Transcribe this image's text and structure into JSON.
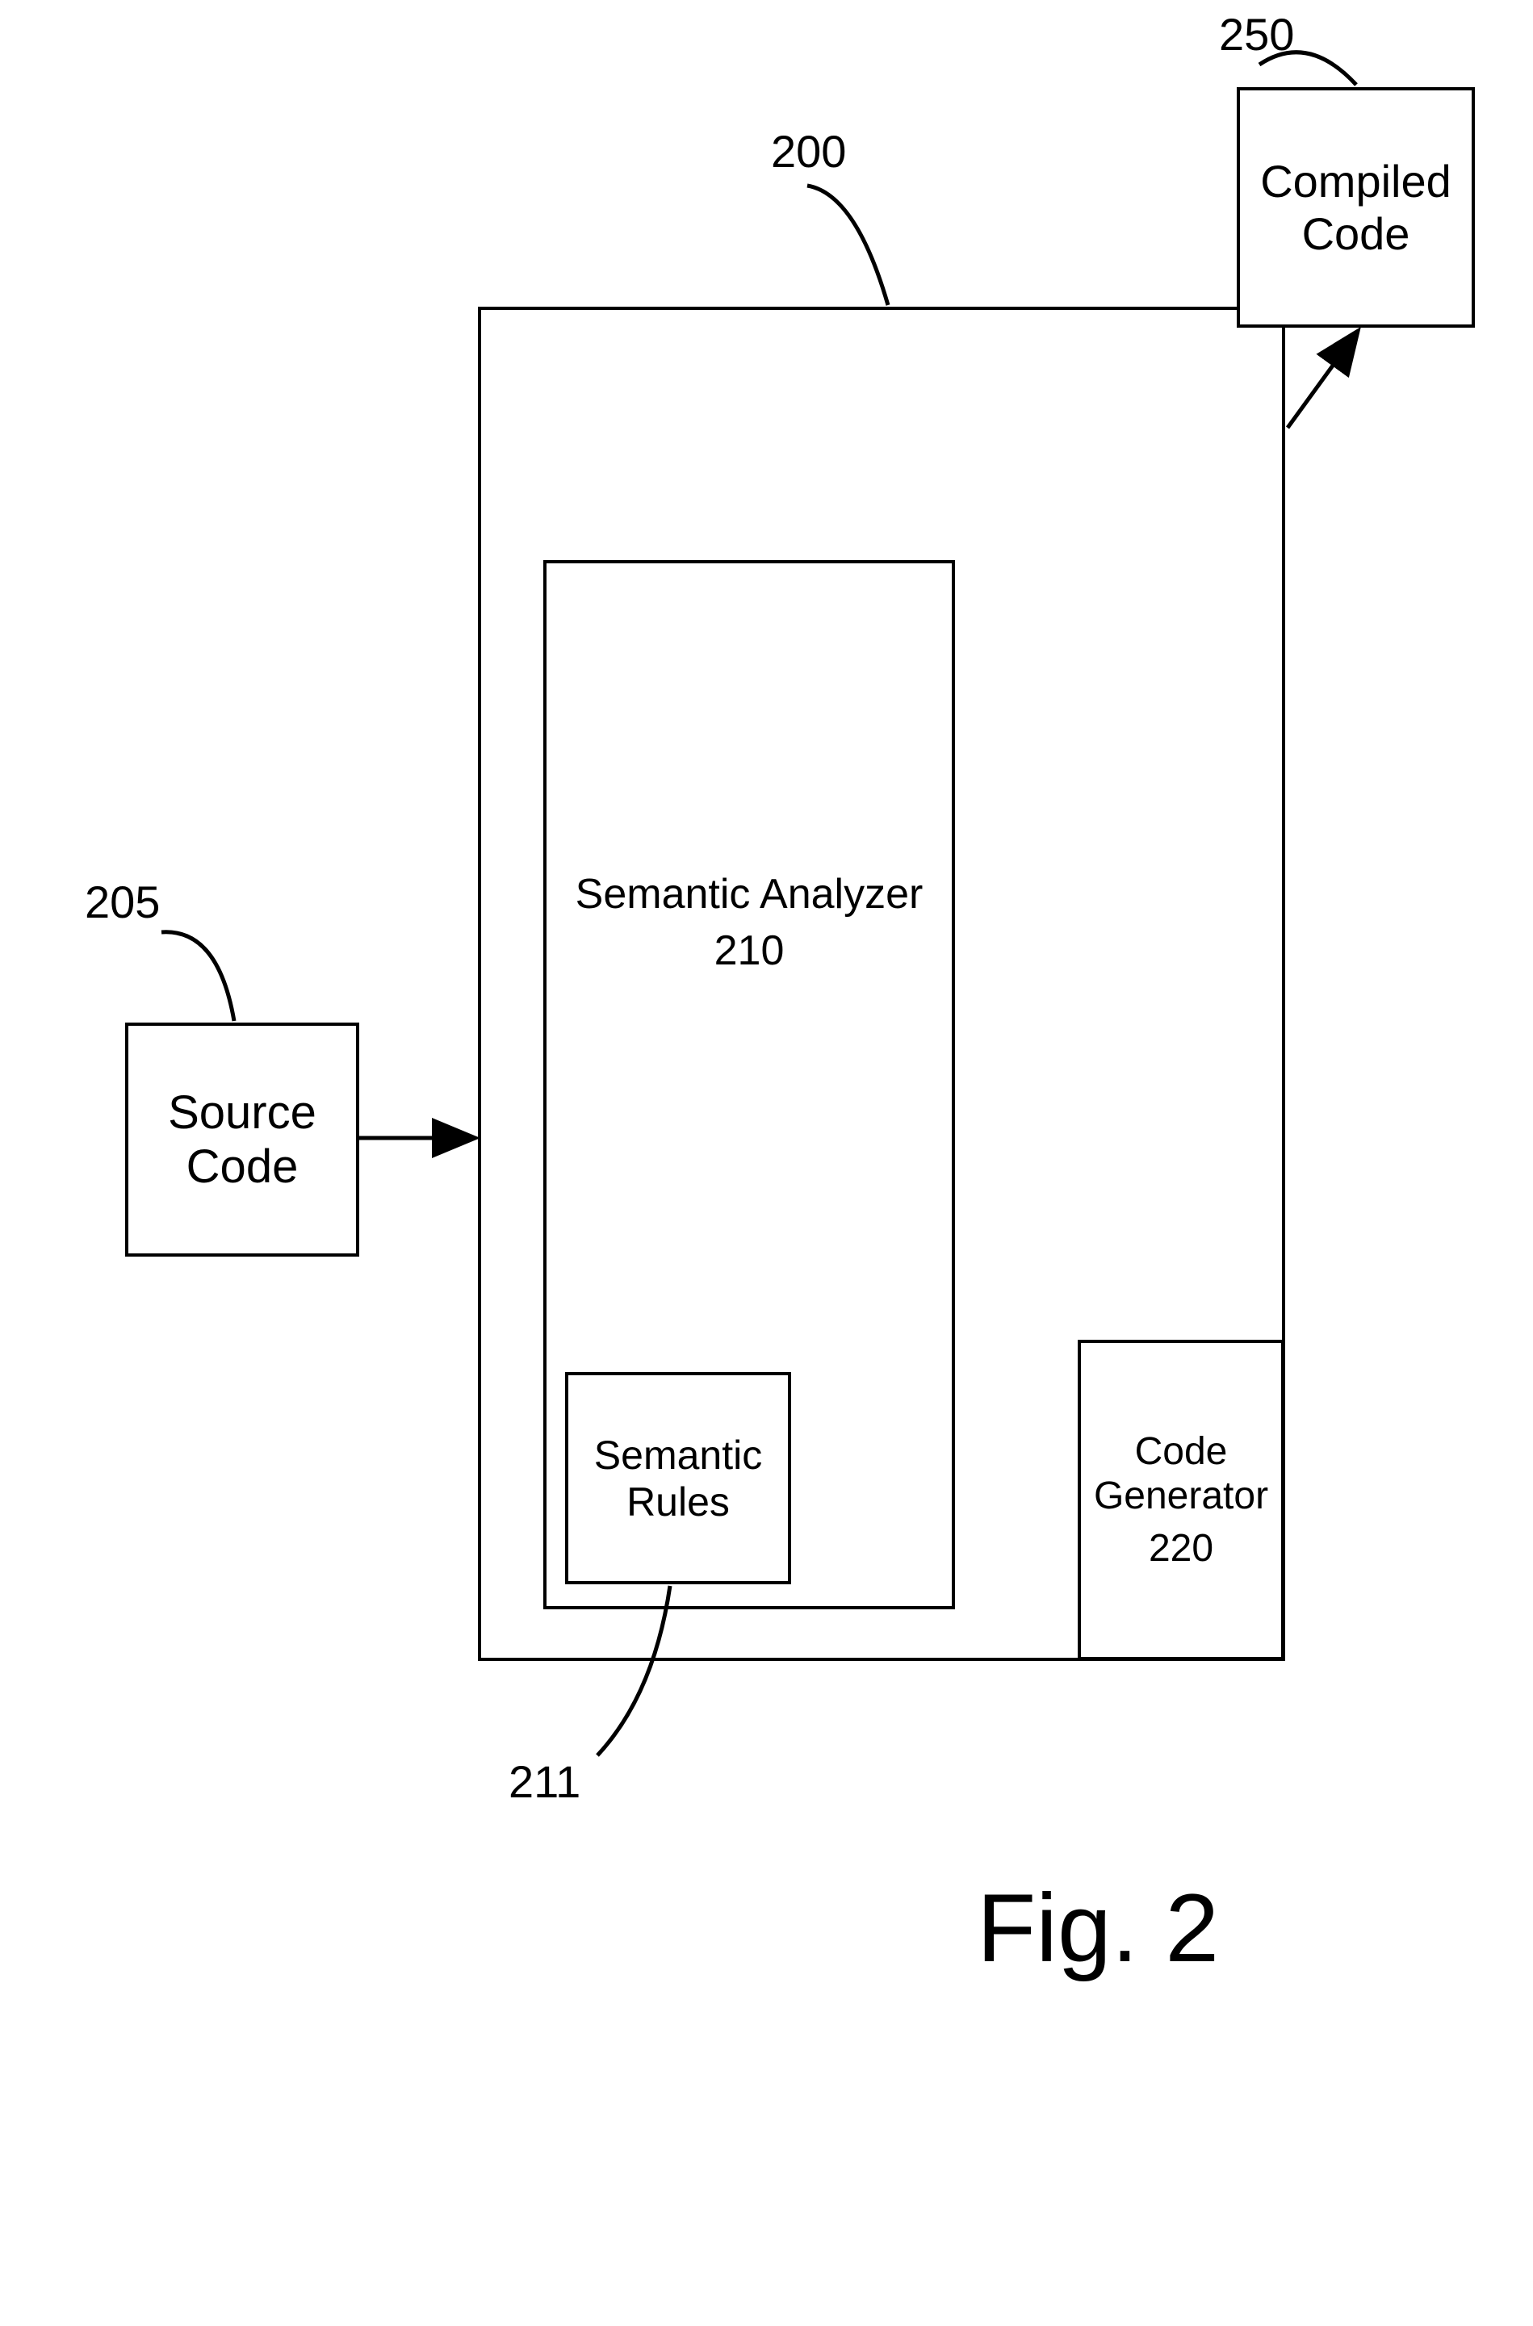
{
  "boxes": {
    "sourceCode": {
      "line1": "Source",
      "line2": "Code",
      "label": "205"
    },
    "compiler": {
      "label": "200"
    },
    "semanticAnalyzer": {
      "line1": "Semantic Analyzer",
      "line2": "210"
    },
    "semanticRules": {
      "line1": "Semantic",
      "line2": "Rules",
      "label": "211"
    },
    "codeGenerator": {
      "line1": "Code Generator",
      "line2": "220"
    },
    "compiledCode": {
      "line1": "Compiled",
      "line2": "Code",
      "label": "250"
    }
  },
  "figureLabel": "Fig. 2"
}
